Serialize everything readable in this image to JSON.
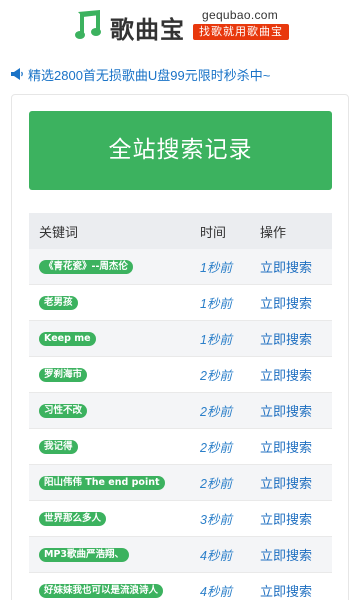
{
  "header": {
    "title": "歌曲宝",
    "domain": "gequbao.com",
    "tagline": "找歌就用歌曲宝",
    "colors": {
      "brand_green": "#3cb25f",
      "tagline_red": "#e8380d"
    }
  },
  "promo": {
    "icon": "speaker-icon",
    "text": "精选2800首无损歌曲U盘99元限时秒杀中~"
  },
  "main": {
    "button_label": "全站搜索记录",
    "table": {
      "headers": {
        "keyword": "关键词",
        "time": "时间",
        "action": "操作"
      },
      "rows": [
        {
          "keyword": "《青花瓷》--周杰伦",
          "time": "1秒前",
          "action": "立即搜索"
        },
        {
          "keyword": "老男孩",
          "time": "1秒前",
          "action": "立即搜索"
        },
        {
          "keyword": "Keep me",
          "time": "1秒前",
          "action": "立即搜索"
        },
        {
          "keyword": "罗刹海市",
          "time": "2秒前",
          "action": "立即搜索"
        },
        {
          "keyword": "习性不改",
          "time": "2秒前",
          "action": "立即搜索"
        },
        {
          "keyword": "我记得",
          "time": "2秒前",
          "action": "立即搜索"
        },
        {
          "keyword": "阳山伟伟 The end point",
          "time": "2秒前",
          "action": "立即搜索"
        },
        {
          "keyword": "世界那么多人",
          "time": "3秒前",
          "action": "立即搜索"
        },
        {
          "keyword": "MP3歌曲严浩翔、",
          "time": "4秒前",
          "action": "立即搜索"
        },
        {
          "keyword": "好妹妹我也可以是流浪诗人",
          "time": "4秒前",
          "action": "立即搜索"
        }
      ]
    }
  }
}
